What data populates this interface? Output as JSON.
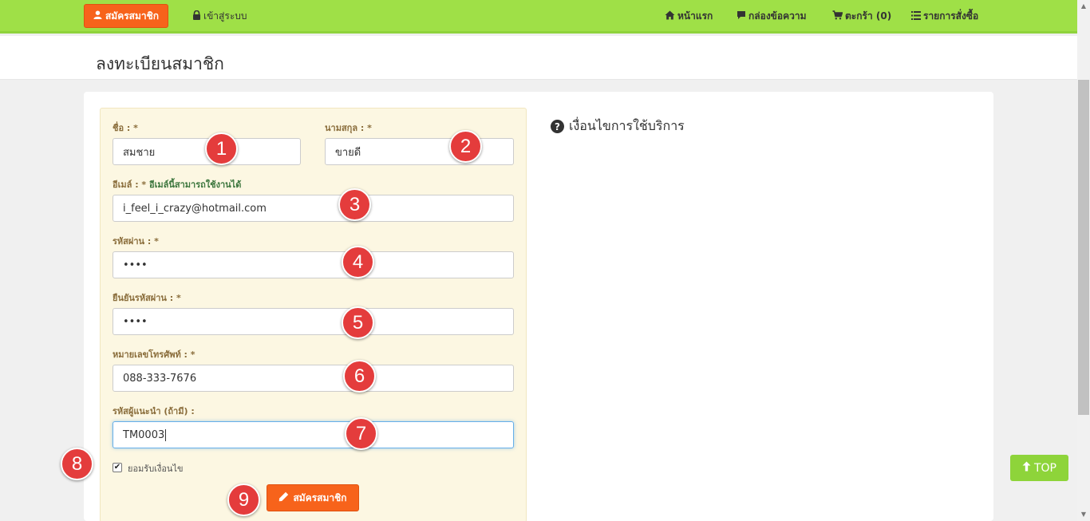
{
  "navbar": {
    "register_label": "สมัครสมาชิก",
    "login_label": "เข้าสู่ระบบ",
    "home_label": "หน้าแรก",
    "inbox_label": "กล่องข้อความ",
    "cart_label": "ตะกร้า (0)",
    "orders_label": "รายการสั่งซื้อ"
  },
  "page": {
    "title": "ลงทะเบียนสมาชิก"
  },
  "form": {
    "first_name": {
      "label": "ชื่อ : *",
      "value": "สมชาย"
    },
    "last_name": {
      "label": "นามสกุล : *",
      "value": "ขายดี"
    },
    "email": {
      "label": "อีเมล์ : *",
      "status": "อีเมล์นี้สามารถใช้งานได้",
      "value": "i_feel_i_crazy@hotmail.com"
    },
    "password": {
      "label": "รหัสผ่าน : *",
      "value": "••••"
    },
    "confirm_password": {
      "label": "ยืนยันรหัสผ่าน : *",
      "value": "••••"
    },
    "phone": {
      "label": "หมายเลขโทรศัพท์ : *",
      "value": "088-333-7676"
    },
    "referral": {
      "label": "รหัสผู้แนะนำ (ถ้ามี) :",
      "value": "TM0003"
    },
    "accept_label": "ยอมรับเงื่อนไข",
    "accept_checked": true,
    "submit_label": "สมัครสมาชิก"
  },
  "terms": {
    "title": "เงื่อนไขการใช้บริการ"
  },
  "top_button": {
    "label": "TOP"
  },
  "badges": [
    "1",
    "2",
    "3",
    "4",
    "5",
    "6",
    "7",
    "8",
    "9"
  ],
  "colors": {
    "navbar": "#9fe047",
    "accent": "#f7631b",
    "badge": "#e43c3c",
    "top_button": "#8ed43a"
  }
}
